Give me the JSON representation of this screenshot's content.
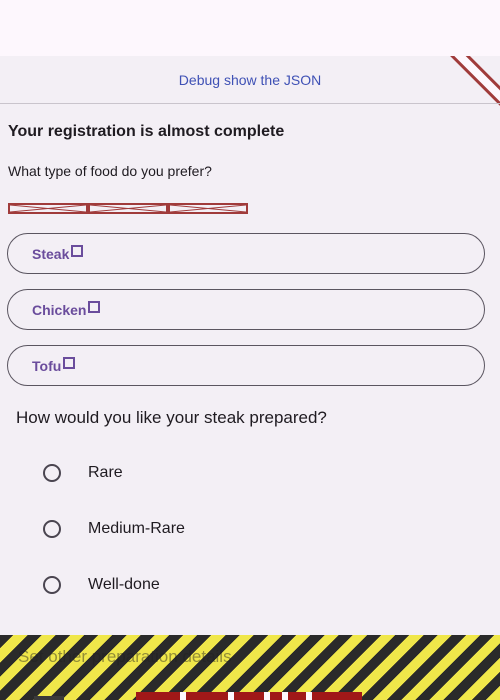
{
  "debug_link": "Debug show the JSON",
  "heading": "Your registration is almost complete",
  "food_question": "What type of food do you prefer?",
  "food_options": [
    {
      "label": "Steak"
    },
    {
      "label": "Chicken"
    },
    {
      "label": "Tofu"
    }
  ],
  "steak_question": "How would you like your steak prepared?",
  "steak_options": [
    {
      "label": "Rare",
      "selected": false
    },
    {
      "label": "Medium-Rare",
      "selected": false
    },
    {
      "label": "Well-done",
      "selected": false
    }
  ],
  "overflow_text": "Set other preparation details",
  "colors": {
    "accent": "#6a4c9c",
    "link": "#3f51b5",
    "debug_banner": "#a03b3b",
    "placeholder_border": "#a03b3b",
    "overflow_stripe_yellow": "#f0e74a",
    "overflow_stripe_dark": "#2a2a2a"
  },
  "icons": {
    "option_checkbox": "square-outline-icon",
    "radio": "radio-unchecked-icon"
  }
}
